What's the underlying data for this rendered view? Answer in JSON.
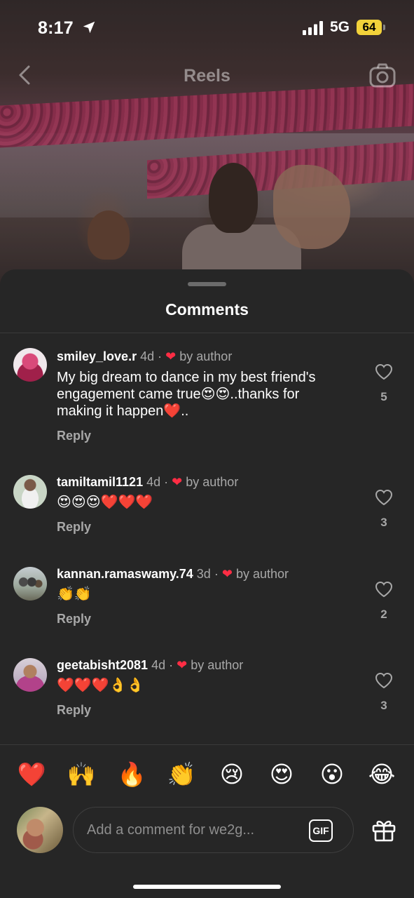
{
  "status_bar": {
    "time": "8:17",
    "network": "5G",
    "battery": "64"
  },
  "header": {
    "title": "Reels"
  },
  "sheet": {
    "title": "Comments"
  },
  "comments": [
    {
      "username": "smiley_love.r",
      "age": "4d",
      "separator": "·",
      "by_author": "by author",
      "text": "My big dream to dance in my best friend's engagement came true😍😍..thanks for making it happen❤️..",
      "reply": "Reply",
      "likes": "5"
    },
    {
      "username": "tamiltamil1121",
      "age": "4d",
      "separator": "·",
      "by_author": "by author",
      "text": "😍😍😍❤️❤️❤️",
      "reply": "Reply",
      "likes": "3"
    },
    {
      "username": "kannan.ramaswamy.74",
      "age": "3d",
      "separator": "·",
      "by_author": "by author",
      "text": "👏👏",
      "reply": "Reply",
      "likes": "2"
    },
    {
      "username": "geetabisht2081",
      "age": "4d",
      "separator": "·",
      "by_author": "by author",
      "text": "❤️❤️❤️👌👌",
      "reply": "Reply",
      "likes": "3"
    }
  ],
  "quick_reactions": [
    "❤️",
    "🙌",
    "🔥",
    "👏",
    "😢",
    "😍",
    "😮",
    "😂"
  ],
  "composer": {
    "placeholder": "Add a comment for we2g...",
    "gif_label": "GIF"
  },
  "colors": {
    "sheet_bg": "#262626",
    "heart_red": "#ff2d44",
    "secondary_text": "#a8a8a8"
  }
}
